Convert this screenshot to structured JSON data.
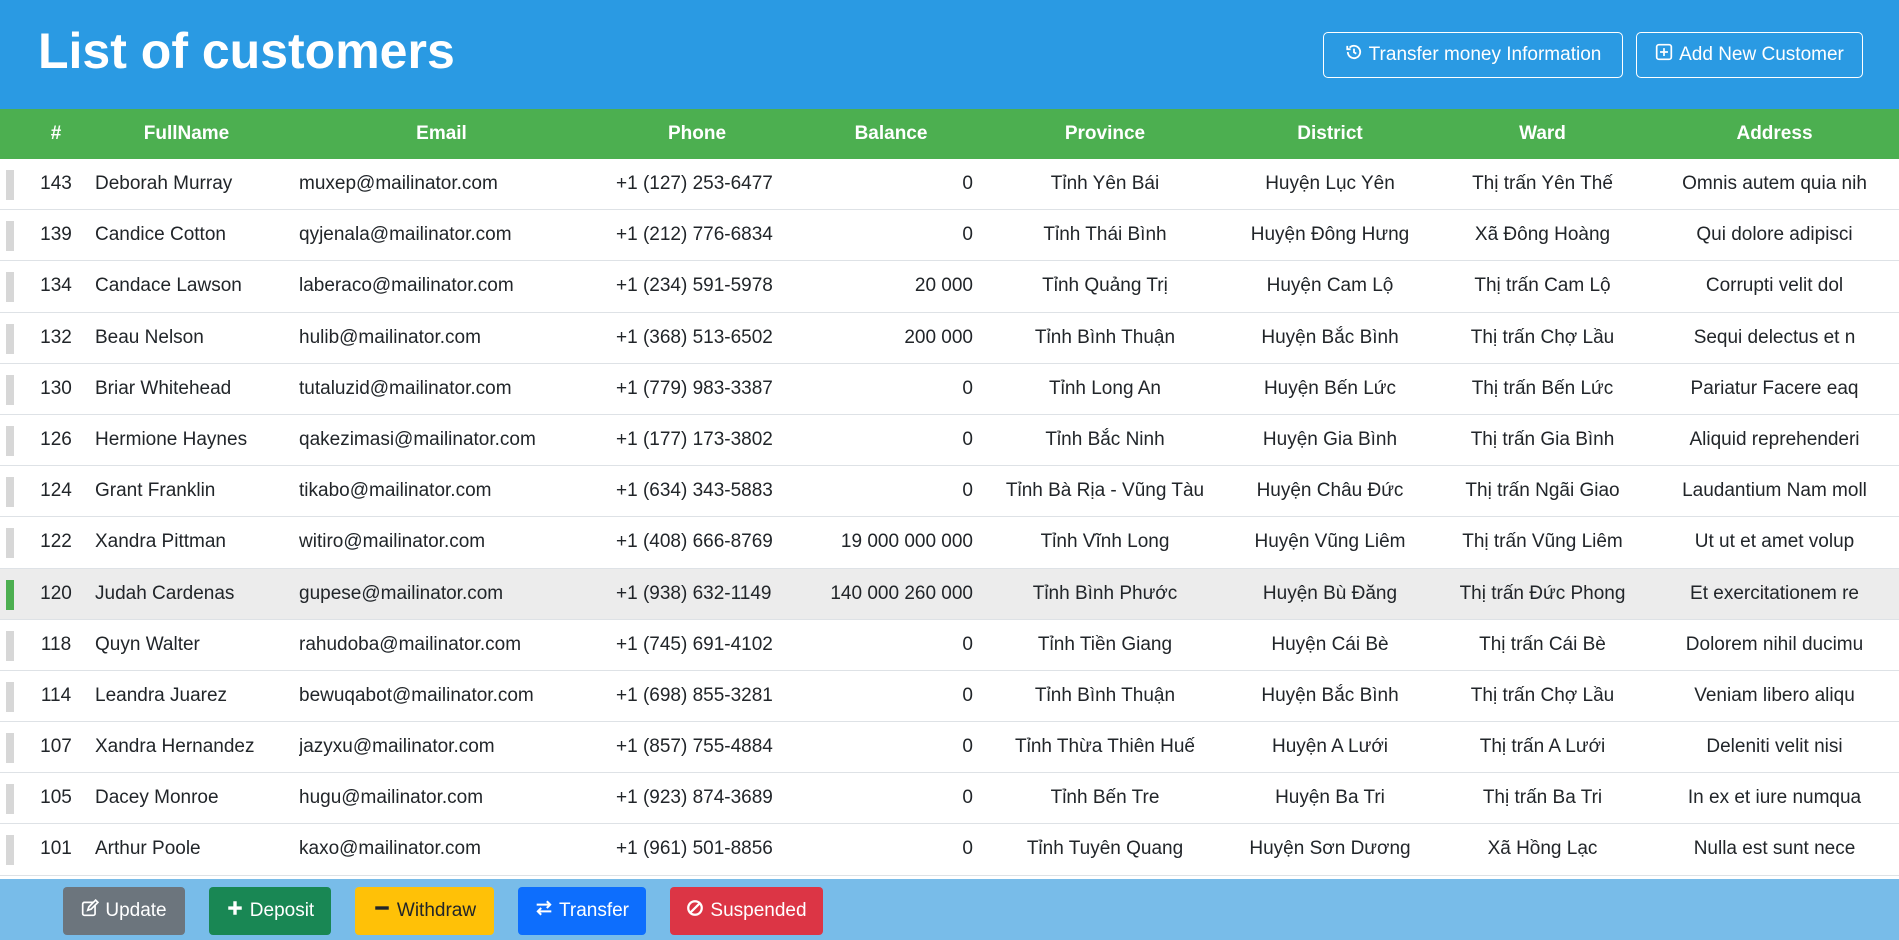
{
  "header": {
    "title": "List of customers",
    "transfer_info_label": "Transfer money Information",
    "add_customer_label": "Add New Customer"
  },
  "table": {
    "columns": [
      "#",
      "FullName",
      "Email",
      "Phone",
      "Balance",
      "Province",
      "District",
      "Ward",
      "Address"
    ],
    "rows": [
      {
        "id": "143",
        "name": "Deborah Murray",
        "email": "muxep@mailinator.com",
        "phone": "+1 (127) 253-6477",
        "balance": "0",
        "province": "Tỉnh Yên Bái",
        "district": "Huyện Lục Yên",
        "ward": "Thị trấn Yên Thế",
        "address": "Omnis autem quia nih"
      },
      {
        "id": "139",
        "name": "Candice Cotton",
        "email": "qyjenala@mailinator.com",
        "phone": "+1 (212) 776-6834",
        "balance": "0",
        "province": "Tỉnh Thái Bình",
        "district": "Huyện Đông Hưng",
        "ward": "Xã Đông Hoàng",
        "address": "Qui dolore adipisci"
      },
      {
        "id": "134",
        "name": "Candace Lawson",
        "email": "laberaco@mailinator.com",
        "phone": "+1 (234) 591-5978",
        "balance": "20 000",
        "province": "Tỉnh Quảng Trị",
        "district": "Huyện Cam Lộ",
        "ward": "Thị trấn Cam Lộ",
        "address": "Corrupti velit dol"
      },
      {
        "id": "132",
        "name": "Beau Nelson",
        "email": "hulib@mailinator.com",
        "phone": "+1 (368) 513-6502",
        "balance": "200 000",
        "province": "Tỉnh Bình Thuận",
        "district": "Huyện Bắc Bình",
        "ward": "Thị trấn Chợ Lầu",
        "address": "Sequi delectus et n"
      },
      {
        "id": "130",
        "name": "Briar Whitehead",
        "email": "tutaluzid@mailinator.com",
        "phone": "+1 (779) 983-3387",
        "balance": "0",
        "province": "Tỉnh Long An",
        "district": "Huyện Bến Lức",
        "ward": "Thị trấn Bến Lức",
        "address": "Pariatur Facere eaq"
      },
      {
        "id": "126",
        "name": "Hermione Haynes",
        "email": "qakezimasi@mailinator.com",
        "phone": "+1 (177) 173-3802",
        "balance": "0",
        "province": "Tỉnh Bắc Ninh",
        "district": "Huyện Gia Bình",
        "ward": "Thị trấn Gia Bình",
        "address": "Aliquid reprehenderi"
      },
      {
        "id": "124",
        "name": "Grant Franklin",
        "email": "tikabo@mailinator.com",
        "phone": "+1 (634) 343-5883",
        "balance": "0",
        "province": "Tỉnh Bà Rịa - Vũng Tàu",
        "district": "Huyện Châu Đức",
        "ward": "Thị trấn Ngãi Giao",
        "address": "Laudantium Nam moll"
      },
      {
        "id": "122",
        "name": "Xandra Pittman",
        "email": "witiro@mailinator.com",
        "phone": "+1 (408) 666-8769",
        "balance": "19 000 000 000",
        "province": "Tỉnh Vĩnh Long",
        "district": "Huyện Vũng Liêm",
        "ward": "Thị trấn Vũng Liêm",
        "address": "Ut ut et amet volup"
      },
      {
        "id": "120",
        "name": "Judah Cardenas",
        "email": "gupese@mailinator.com",
        "phone": "+1 (938) 632-1149",
        "balance": "140 000 260 000",
        "province": "Tỉnh Bình Phước",
        "district": "Huyện Bù Đăng",
        "ward": "Thị trấn Đức Phong",
        "address": "Et exercitationem re",
        "selected": true
      },
      {
        "id": "118",
        "name": "Quyn Walter",
        "email": "rahudoba@mailinator.com",
        "phone": "+1 (745) 691-4102",
        "balance": "0",
        "province": "Tỉnh Tiền Giang",
        "district": "Huyện Cái Bè",
        "ward": "Thị trấn Cái Bè",
        "address": "Dolorem nihil ducimu"
      },
      {
        "id": "114",
        "name": "Leandra Juarez",
        "email": "bewuqabot@mailinator.com",
        "phone": "+1 (698) 855-3281",
        "balance": "0",
        "province": "Tỉnh Bình Thuận",
        "district": "Huyện Bắc Bình",
        "ward": "Thị trấn Chợ Lầu",
        "address": "Veniam libero aliqu"
      },
      {
        "id": "107",
        "name": "Xandra Hernandez",
        "email": "jazyxu@mailinator.com",
        "phone": "+1 (857) 755-4884",
        "balance": "0",
        "province": "Tỉnh Thừa Thiên Huế",
        "district": "Huyện A Lưới",
        "ward": "Thị trấn A Lưới",
        "address": "Deleniti velit nisi"
      },
      {
        "id": "105",
        "name": "Dacey Monroe",
        "email": "hugu@mailinator.com",
        "phone": "+1 (923) 874-3689",
        "balance": "0",
        "province": "Tỉnh Bến Tre",
        "district": "Huyện Ba Tri",
        "ward": "Thị trấn Ba Tri",
        "address": "In ex et iure numqua"
      },
      {
        "id": "101",
        "name": "Arthur Poole",
        "email": "kaxo@mailinator.com",
        "phone": "+1 (961) 501-8856",
        "balance": "0",
        "province": "Tỉnh Tuyên Quang",
        "district": "Huyện Sơn Dương",
        "ward": "Xã Hồng Lạc",
        "address": "Nulla est sunt nece"
      }
    ]
  },
  "footer": {
    "update_label": "Update",
    "deposit_label": "Deposit",
    "withdraw_label": "Withdraw",
    "transfer_label": "Transfer",
    "suspended_label": "Suspended"
  },
  "colors": {
    "header_bg": "#2a9ae3",
    "table_header_bg": "#4caf50",
    "footer_bg": "#78bce9",
    "selected_row_marker": "#4caf50"
  }
}
